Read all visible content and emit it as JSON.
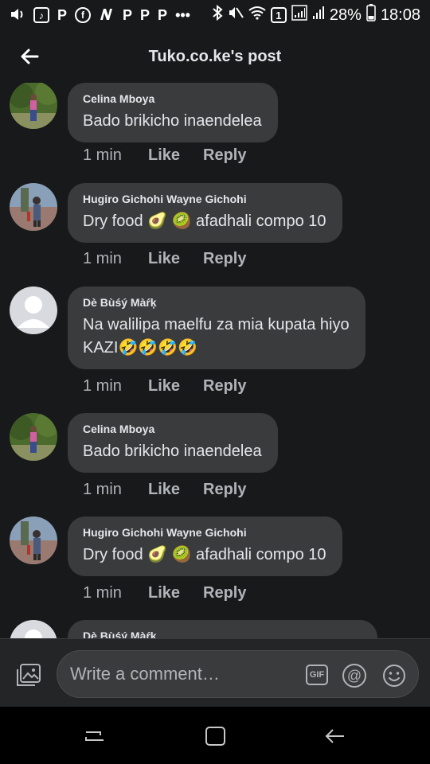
{
  "status_bar": {
    "battery": "28%",
    "time": "18:08",
    "sim_label": "1",
    "app_letters": [
      "P",
      "P",
      "P",
      "P"
    ],
    "more": "•••"
  },
  "header": {
    "title": "Tuko.co.ke's post"
  },
  "comments": [
    {
      "author": "Celina Mboya",
      "lines": [
        "Bado brikicho inaendelea"
      ],
      "time": "1 min",
      "like": "Like",
      "reply": "Reply",
      "avatar": "photo-green"
    },
    {
      "author": "Hugiro Gichohi Wayne Gichohi",
      "lines": [
        "Dry food 🥑 🥝  afadhali compo 10"
      ],
      "time": "1 min",
      "like": "Like",
      "reply": "Reply",
      "avatar": "photo-road"
    },
    {
      "author": "Dè Bùśý Màŕķ",
      "lines": [
        "Na walilipa maelfu za mia kupata hiyo",
        "KAZI🤣🤣🤣🤣"
      ],
      "time": "1 min",
      "like": "Like",
      "reply": "Reply",
      "avatar": "default"
    },
    {
      "author": "Celina Mboya",
      "lines": [
        "Bado brikicho inaendelea"
      ],
      "time": "1 min",
      "like": "Like",
      "reply": "Reply",
      "avatar": "photo-green"
    },
    {
      "author": "Hugiro Gichohi Wayne Gichohi",
      "lines": [
        "Dry food 🥑 🥝  afadhali compo 10"
      ],
      "time": "1 min",
      "like": "Like",
      "reply": "Reply",
      "avatar": "photo-road"
    },
    {
      "author": "Dè Bùśý Màŕķ",
      "lines": [],
      "time": "",
      "like": "",
      "reply": "",
      "avatar": "default"
    }
  ],
  "composer": {
    "placeholder": "Write a comment…",
    "gif_label": "GIF",
    "at_label": "@",
    "icons": [
      "photo-icon",
      "gif-icon",
      "mention-icon",
      "emoji-icon"
    ]
  },
  "navbar": {
    "icons": [
      "recent-apps-icon",
      "home-icon",
      "back-icon"
    ]
  },
  "colors": {
    "background": "#18191a",
    "bubble": "#3a3b3c",
    "primary_text": "#e4e6eb",
    "secondary_text": "#b0b3b8"
  }
}
